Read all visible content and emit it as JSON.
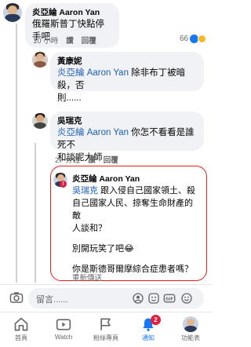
{
  "comment1": {
    "author": "炎亞綸 Aaron Yan",
    "text": "俄羅斯普丁快點停手吧",
    "time": "10 小時",
    "reply_label": "讚",
    "reply_action": "回覆",
    "reaction_count": "66"
  },
  "reply1": {
    "author": "黃康妮",
    "mention": "炎亞綸 Aaron Yan",
    "text_line1": " 除非布丁被暗殺，否",
    "text_line2": "則......"
  },
  "reply2": {
    "author": "吳瑞克",
    "mention": "炎亞綸 Aaron Yan",
    "text_line1": " 你怎不看看是誰死不",
    "text_line2": "和談呢大師",
    "time": "27 分鐘",
    "like_label": "讚",
    "reply_action": "回覆"
  },
  "reply3": {
    "author": "炎亞綸 Aaron Yan",
    "mention": "吳瑞克",
    "line1": " 跟入侵自己國家領土、殺",
    "line2": "自己國家人民、掠奪生命財產的敵",
    "line3": "人談和？",
    "line4": "別開玩笑了吧😂",
    "line5": "你是斯德哥爾摩綜合症患者嗎？",
    "sending": "重新傳送"
  },
  "comment_input": {
    "placeholder": "留言......"
  },
  "tabs": [
    {
      "label": "首頁"
    },
    {
      "label": "Watch"
    },
    {
      "label": "粉絲專頁"
    },
    {
      "label": "通知",
      "badge": "2"
    },
    {
      "label": "功能表"
    }
  ],
  "colors": {
    "accent": "#1877f2",
    "mention": "#1d5fb7",
    "highlight": "#e0211d",
    "badge": "#e41e3f"
  }
}
